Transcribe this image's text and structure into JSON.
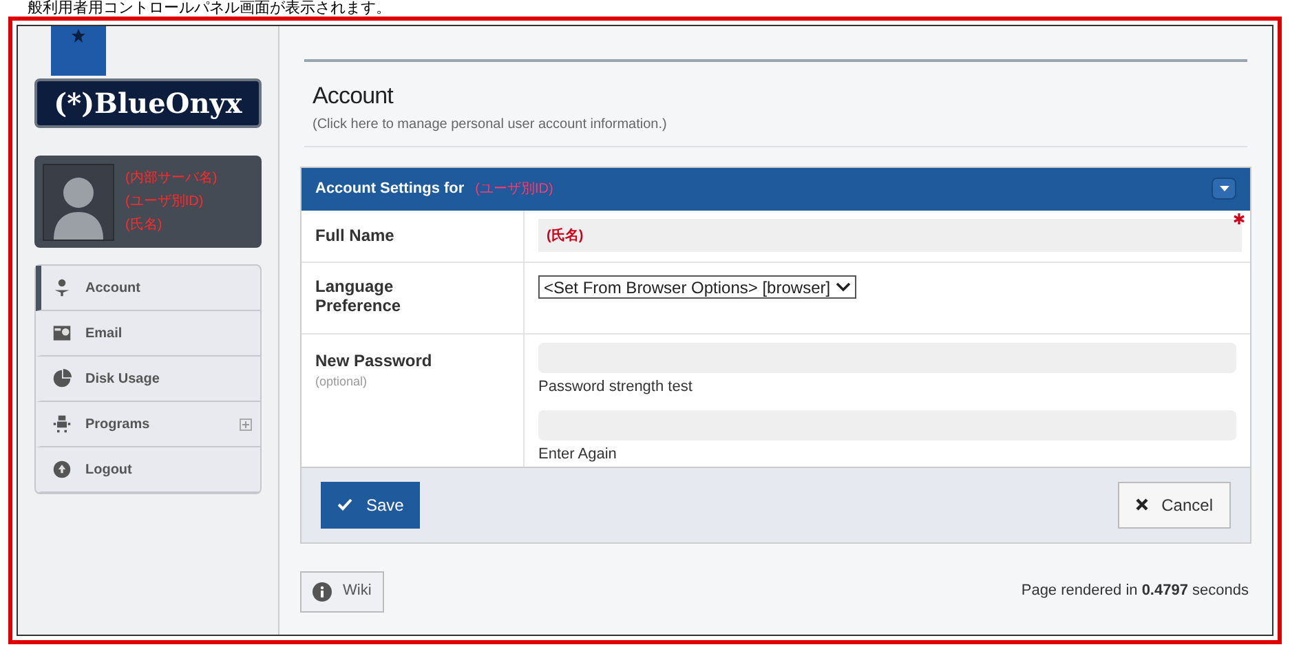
{
  "caption": "般利用者用コントロールパネル画面が表示されます。",
  "logo": {
    "text": "(*)BlueOnyx"
  },
  "profile": {
    "lines": [
      "(内部サーバ名)",
      "(ユーザ別ID)",
      "(氏名)"
    ]
  },
  "sidebar": {
    "items": [
      {
        "label": "Account",
        "selected": true,
        "expandable": false
      },
      {
        "label": "Email",
        "selected": false,
        "expandable": false
      },
      {
        "label": "Disk Usage",
        "selected": false,
        "expandable": false
      },
      {
        "label": "Programs",
        "selected": false,
        "expandable": true
      },
      {
        "label": "Logout",
        "selected": false,
        "expandable": false
      }
    ]
  },
  "page": {
    "title": "Account",
    "subtitle": "(Click here to manage personal user account information.)"
  },
  "panel": {
    "title": "Account Settings for",
    "user": "(ユーザ別ID)",
    "full_name": {
      "label": "Full Name",
      "value": "(氏名)",
      "required": true
    },
    "language": {
      "label": "Language Preference",
      "value": "<Set From Browser Options> [browser]"
    },
    "password": {
      "label": "New Password",
      "note": "(optional)",
      "hint1": "Password strength test",
      "hint2": "Enter Again"
    },
    "buttons": {
      "save": "Save",
      "cancel": "Cancel"
    }
  },
  "footer": {
    "wiki": "Wiki",
    "rendered": "Page rendered in **0.4797** seconds"
  }
}
